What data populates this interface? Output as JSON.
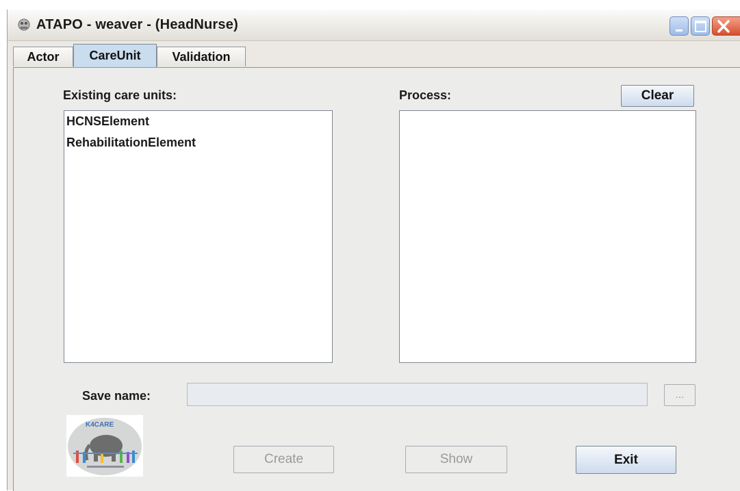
{
  "window": {
    "title": "ATAPO - weaver - (HeadNurse)",
    "controls": [
      "minimize-icon",
      "maximize-icon",
      "close-icon"
    ]
  },
  "tabs": [
    {
      "label": "Actor",
      "selected": false
    },
    {
      "label": "CareUnit",
      "selected": true
    },
    {
      "label": "Validation",
      "selected": false
    }
  ],
  "care_units": {
    "label": "Existing care units:",
    "items": [
      "HCNSElement",
      "RehabilitationElement"
    ]
  },
  "process": {
    "label": "Process:",
    "clear_label": "Clear",
    "items": []
  },
  "save": {
    "label": "Save name:",
    "value": "",
    "browse_label": "..."
  },
  "actions": {
    "create_label": "Create",
    "show_label": "Show",
    "exit_label": "Exit"
  },
  "logo": {
    "text": "K4CARE"
  },
  "colors": {
    "selected_tab": "#c9ddef",
    "panel": "#ececeb",
    "button_gradient_bottom": "#cddcee"
  }
}
